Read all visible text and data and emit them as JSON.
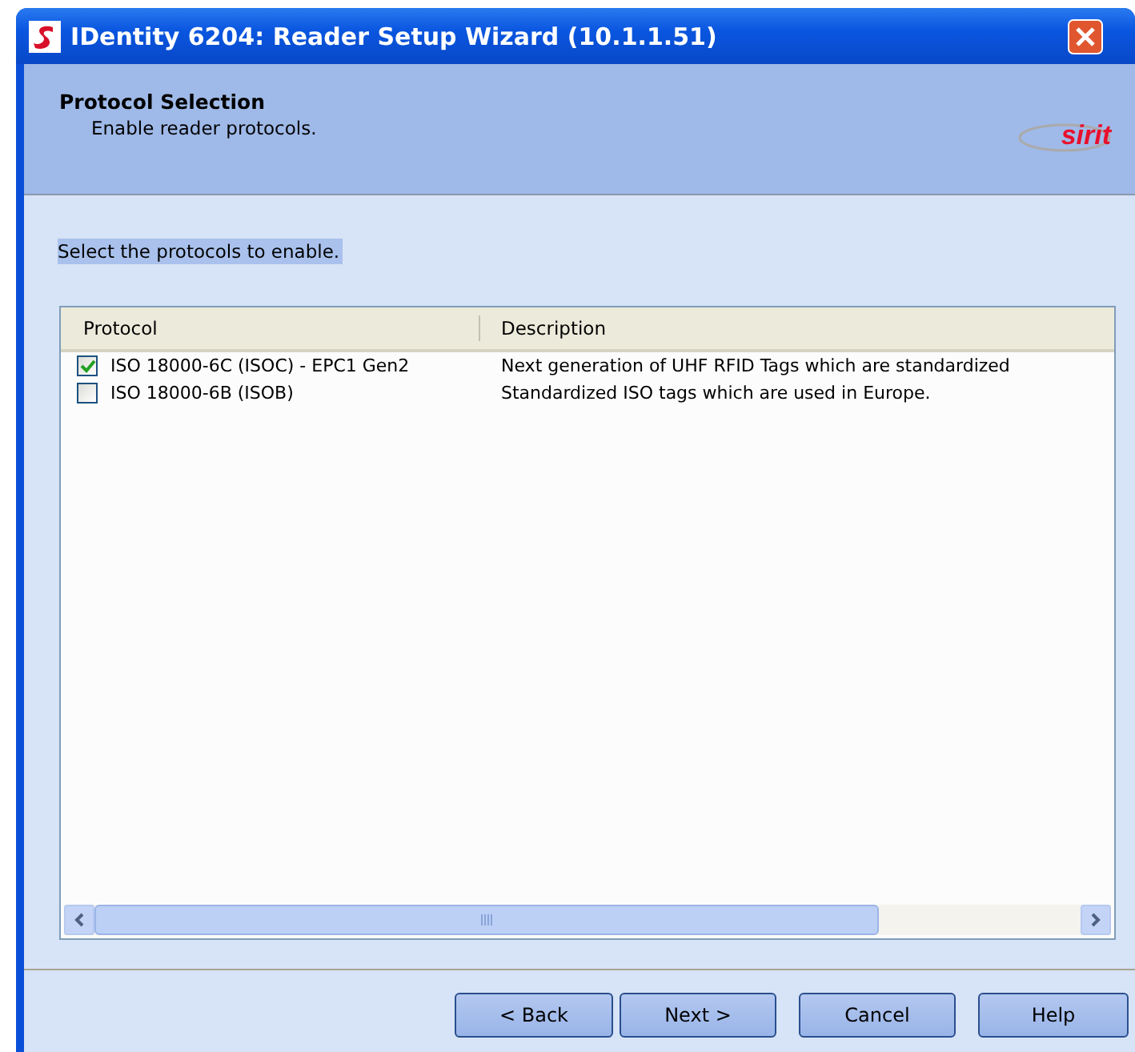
{
  "window": {
    "title": "IDentity 6204: Reader Setup Wizard (10.1.1.51)"
  },
  "header": {
    "title": "Protocol Selection",
    "subtitle": "Enable reader protocols.",
    "logo": "sirit"
  },
  "instruction": "Select the protocols to enable.",
  "table": {
    "columns": [
      "Protocol",
      "Description"
    ],
    "rows": [
      {
        "protocol": "ISO 18000-6C (ISOC) - EPC1 Gen2",
        "description": "Next generation of UHF RFID Tags which are standardized",
        "checked": true
      },
      {
        "protocol": "ISO 18000-6B (ISOB)",
        "description": "Standardized ISO tags which are used in Europe.",
        "checked": false
      }
    ]
  },
  "buttons": [
    "< Back",
    "Next >",
    "Cancel",
    "Help"
  ]
}
